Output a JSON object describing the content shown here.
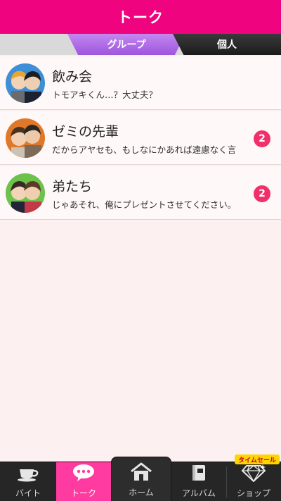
{
  "header": {
    "title": "トーク"
  },
  "tabs": {
    "group": "グループ",
    "personal": "個人"
  },
  "chats": [
    {
      "name": "飲み会",
      "preview": "トモアキくん…？大丈夫？",
      "unread": ""
    },
    {
      "name": "ゼミの先輩",
      "preview": "だからアヤセも、もしなにかあれば遠慮なく言",
      "unread": "2"
    },
    {
      "name": "弟たち",
      "preview": "じゃあそれ、俺にプレゼントさせてください。",
      "unread": "2"
    }
  ],
  "nav": {
    "part_time": "バイト",
    "talk": "トーク",
    "home": "ホーム",
    "album": "アルバム",
    "shop": "ショップ",
    "sale_label": "タイムセール"
  },
  "colors": {
    "header": "#f0037f",
    "tab_group": "#a962e3",
    "tab_personal": "#252525",
    "badge": "#f0306a",
    "nav_active": "#ff3aa0",
    "background": "#fdf0f0"
  }
}
